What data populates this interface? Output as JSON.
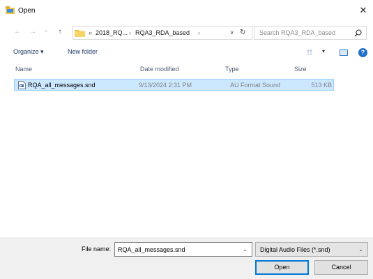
{
  "window": {
    "title": "Open",
    "icons": {
      "app": "open-dialog-icon",
      "close": "close-icon"
    }
  },
  "nav": {
    "back": "←",
    "forward": "→",
    "recent": "˅",
    "up": "↑",
    "breadcrumb": {
      "overflow": "«",
      "items": [
        "2018_RQ...",
        "RQA3_RDA_based"
      ],
      "separator": "›"
    },
    "address_dropdown": "˅",
    "refresh": "↻",
    "search_placeholder": "Search RQA3_RDA_based"
  },
  "toolbar": {
    "organize": "Organize ▾",
    "new_folder": "New folder",
    "view_dropdown": "▾"
  },
  "file_list": {
    "columns": [
      "Name",
      "Date modified",
      "Type",
      "Size"
    ],
    "rows": [
      {
        "name": "RQA_all_messages.snd",
        "date": "9/13/2024 2:31 PM",
        "type": "AU Format Sound",
        "size": "513 KB",
        "selected": true
      }
    ]
  },
  "footer": {
    "file_name_label": "File name:",
    "file_name_value": "RQA_all_messages.snd",
    "file_type_value": "Digital Audio Files (*.snd)",
    "open_button": "Open",
    "cancel_button": "Cancel"
  },
  "colors": {
    "selection": "#cce8ff",
    "selection_border": "#99d1ff",
    "accent": "#0078d7",
    "folder": "#f4c542"
  }
}
